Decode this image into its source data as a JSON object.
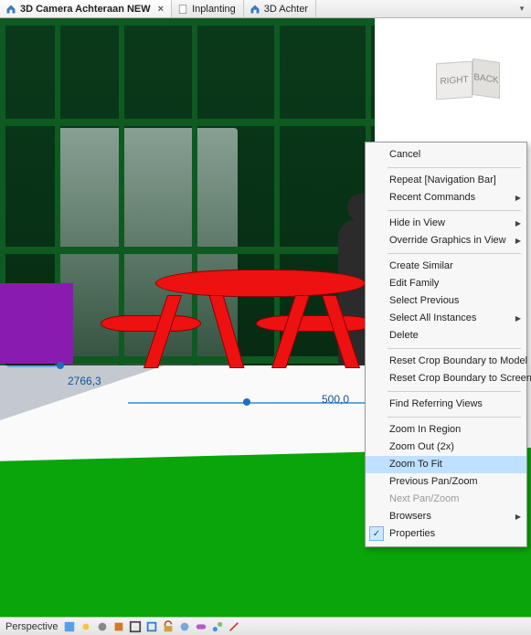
{
  "tabs": {
    "items": [
      {
        "label": "3D Camera Achteraan NEW",
        "active": true,
        "closable": true
      },
      {
        "label": "Inplanting",
        "active": false,
        "closable": false
      },
      {
        "label": "3D Achter",
        "active": false,
        "closable": false
      }
    ]
  },
  "viewcube": {
    "front": "RIGHT",
    "right": "BACK"
  },
  "dimensions": {
    "left_value": "2766,3",
    "bottom_value": "500,0"
  },
  "context_menu": {
    "groups": [
      [
        {
          "label": "Cancel",
          "submenu": false
        }
      ],
      [
        {
          "label": "Repeat [Navigation Bar]",
          "submenu": false
        },
        {
          "label": "Recent Commands",
          "submenu": true
        }
      ],
      [
        {
          "label": "Hide in View",
          "submenu": true
        },
        {
          "label": "Override Graphics in View",
          "submenu": true
        }
      ],
      [
        {
          "label": "Create Similar",
          "submenu": false
        },
        {
          "label": "Edit Family",
          "submenu": false
        },
        {
          "label": "Select Previous",
          "submenu": false
        },
        {
          "label": "Select All Instances",
          "submenu": true
        },
        {
          "label": "Delete",
          "submenu": false
        }
      ],
      [
        {
          "label": "Reset Crop Boundary to Model",
          "submenu": false
        },
        {
          "label": "Reset Crop Boundary to Screen",
          "submenu": false
        }
      ],
      [
        {
          "label": "Find Referring Views",
          "submenu": false
        }
      ],
      [
        {
          "label": "Zoom In Region",
          "submenu": false
        },
        {
          "label": "Zoom Out (2x)",
          "submenu": false
        },
        {
          "label": "Zoom To Fit",
          "submenu": false,
          "highlight": true
        },
        {
          "label": "Previous Pan/Zoom",
          "submenu": false
        },
        {
          "label": "Next Pan/Zoom",
          "submenu": false,
          "disabled": true
        },
        {
          "label": "Browsers",
          "submenu": true
        },
        {
          "label": "Properties",
          "submenu": false,
          "checked": true
        }
      ]
    ]
  },
  "status": {
    "mode": "Perspective"
  }
}
